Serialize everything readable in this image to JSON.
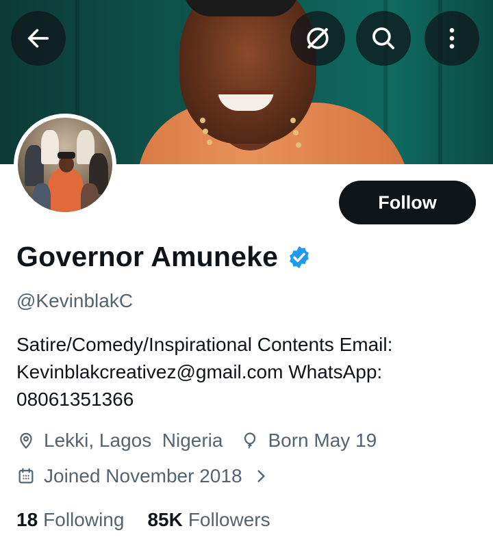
{
  "header": {
    "back_icon": "arrow-left-icon",
    "grok_icon": "slash-circle-icon",
    "search_icon": "search-icon",
    "more_icon": "more-vertical-icon"
  },
  "profile": {
    "display_name": "Governor Amuneke",
    "verified": true,
    "handle": "@KevinblakC",
    "follow_label": "Follow",
    "bio": "Satire/Comedy/Inspirational Contents Email: Kevinblakcreativez@gmail.com WhatsApp: 08061351366",
    "location": "Lekki, Lagos  Nigeria",
    "birthday": "Born May 19",
    "joined": "Joined November 2018",
    "following_count": "18",
    "following_label": "Following",
    "followers_count": "85K",
    "followers_label": "Followers"
  },
  "colors": {
    "primary_text": "#0f1419",
    "secondary_text": "#536471",
    "verified_blue": "#1d9bf0",
    "button_dark": "#0f1419"
  }
}
